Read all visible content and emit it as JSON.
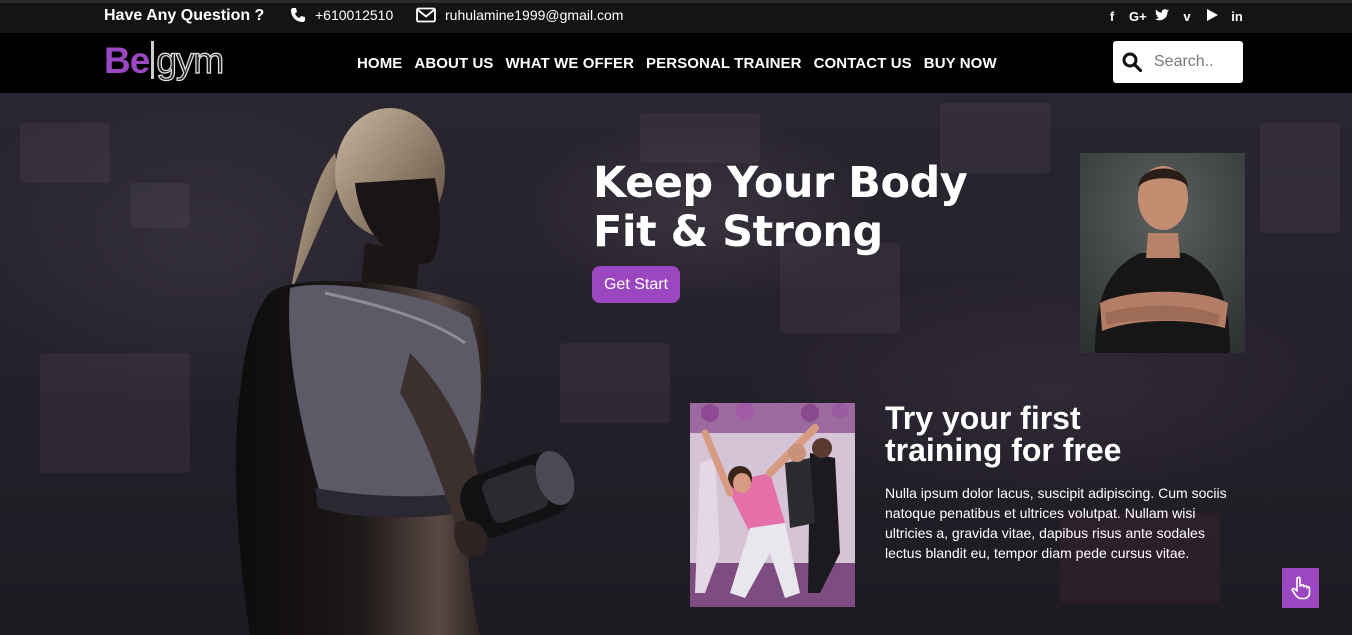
{
  "topbar": {
    "question": "Have Any Question ?",
    "phone": "+610012510",
    "email": "ruhulamine1999@gmail.com",
    "socials": [
      {
        "icon": "facebook-icon",
        "glyph": "f"
      },
      {
        "icon": "google-plus-icon",
        "glyph": "G+"
      },
      {
        "icon": "twitter-icon",
        "glyph": "🐦"
      },
      {
        "icon": "vimeo-icon",
        "glyph": "v"
      },
      {
        "icon": "youtube-icon",
        "glyph": "▶"
      },
      {
        "icon": "linkedin-icon",
        "glyph": "in"
      }
    ]
  },
  "nav": {
    "logo_be": "Be",
    "logo_gym": "gym",
    "menu": [
      "HOME",
      "ABOUT US",
      "WHAT WE OFFER",
      "PERSONAL TRAINER",
      "CONTACT US",
      "BUY NOW"
    ],
    "search_placeholder": "Search.."
  },
  "hero": {
    "title_line1": "Keep Your Body",
    "title_line2": "Fit & Strong",
    "cta_label": "Get Start",
    "offer_line1": "Try your first",
    "offer_line2": "training for free",
    "description": "Nulla ipsum dolor lacus, suscipit adipiscing. Cum sociis natoque penatibus et ultrices volutpat. Nullam wisi ultricies a, gravida vitae, dapibus risus ante sodales lectus blandit eu, tempor diam pede cursus vitae."
  },
  "colors": {
    "accent": "#9b47c0",
    "topbar": "#141414",
    "navbar": "#000000"
  }
}
